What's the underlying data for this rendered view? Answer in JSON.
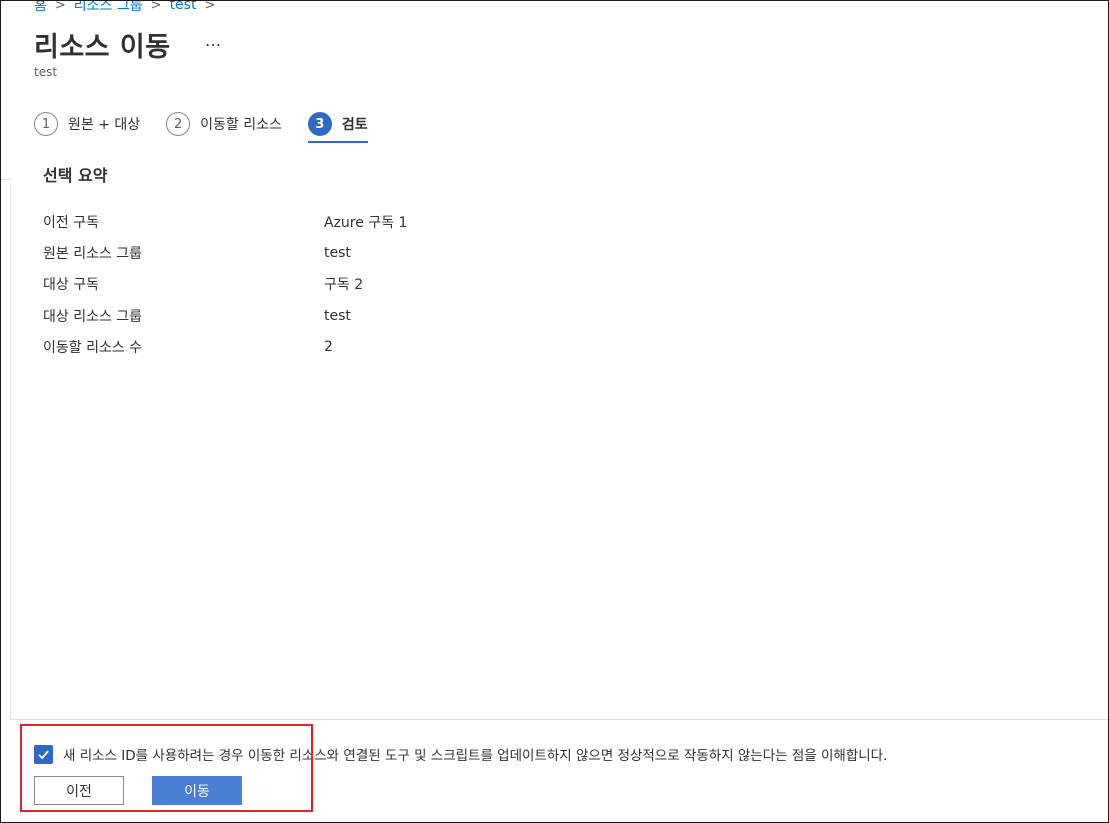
{
  "breadcrumb": {
    "items": [
      "홈",
      "리소스 그룹",
      "test"
    ]
  },
  "page": {
    "title": "리소스 이동",
    "more": "…",
    "subtitle": "test"
  },
  "steps": [
    {
      "number": "1",
      "label": "원본 + 대상",
      "active": false
    },
    {
      "number": "2",
      "label": "이동할 리소스",
      "active": false
    },
    {
      "number": "3",
      "label": "검토",
      "active": true
    }
  ],
  "summary": {
    "title": "선택 요약",
    "rows": [
      {
        "key": "이전 구독",
        "value": "Azure 구독 1"
      },
      {
        "key": "원본 리소스 그룹",
        "value": "test"
      },
      {
        "key": "대상 구독",
        "value": "구독 2"
      },
      {
        "key": "대상 리소스 그룹",
        "value": "test"
      },
      {
        "key": "이동할 리소스 수",
        "value": "2"
      }
    ]
  },
  "footer": {
    "consent_text": "새 리소스 ID를 사용하려는 경우 이동한 리소스와 연결된 도구 및 스크립트를 업데이트하지 않으면 정상적으로 작동하지 않는다는 점을 이해합니다.",
    "consent_checked": true,
    "prev_label": "이전",
    "move_label": "이동"
  },
  "colors": {
    "accent": "#2f68c5",
    "link": "#0078d4",
    "highlight": "#e02424"
  }
}
